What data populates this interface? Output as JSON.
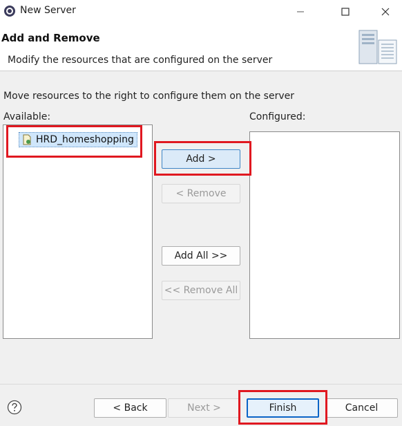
{
  "window": {
    "title": "New Server",
    "minimize_icon": "minimize-icon",
    "maximize_icon": "maximize-icon",
    "close_icon": "close-icon"
  },
  "banner": {
    "title": "Add and Remove",
    "description": "Modify the resources that are configured on the server",
    "graphic_icon": "server-wizard-icon"
  },
  "instruction": "Move resources to the right to configure them on the server",
  "available": {
    "label": "Available:",
    "items": [
      {
        "label": "HRD_homeshopping",
        "icon": "web-project-icon",
        "selected": true
      }
    ]
  },
  "configured": {
    "label": "Configured:",
    "items": []
  },
  "transfer_buttons": {
    "add": "Add >",
    "remove": "< Remove",
    "add_all": "Add All >>",
    "remove_all": "<< Remove All"
  },
  "footer": {
    "help_icon": "help-icon",
    "back": "< Back",
    "next": "Next >",
    "finish": "Finish",
    "cancel": "Cancel"
  },
  "colors": {
    "highlight": "#e01820",
    "selection": "#cfe6fb",
    "accent": "#0a64c7"
  }
}
